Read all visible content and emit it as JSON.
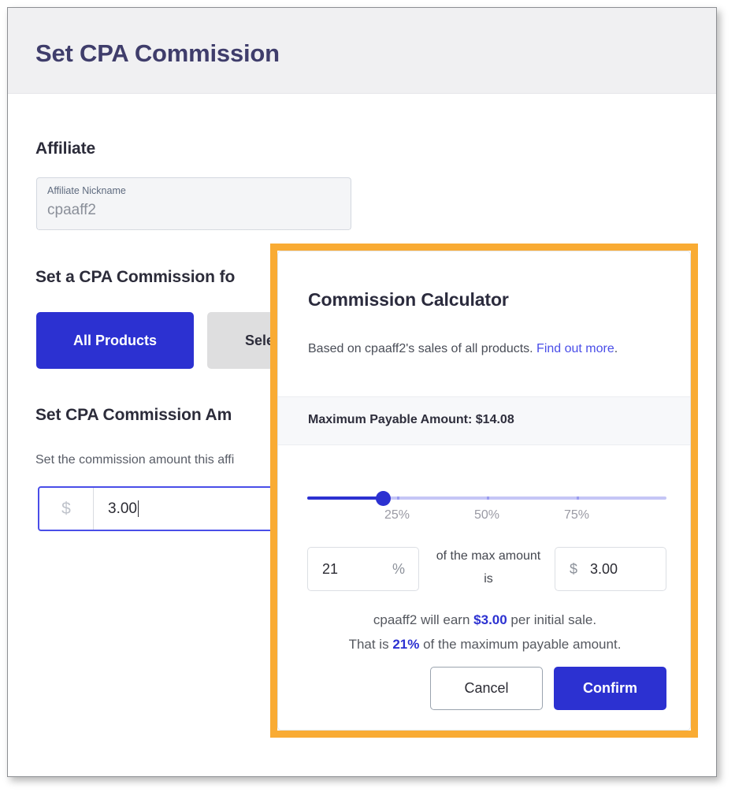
{
  "header": {
    "title": "Set CPA Commission"
  },
  "affiliate": {
    "heading": "Affiliate",
    "field_label": "Affiliate Nickname",
    "field_value": "cpaaff2"
  },
  "scope": {
    "heading": "Set a CPA Commission fo",
    "buttons": [
      {
        "label": "All Products",
        "selected": true
      },
      {
        "label": "Selec",
        "selected": false
      }
    ]
  },
  "amount_section": {
    "heading": "Set CPA Commission Am",
    "helper": "Set the commission amount this affi",
    "currency_symbol": "$",
    "value": "3.00"
  },
  "modal": {
    "title": "Commission Calculator",
    "description_prefix": "Based on cpaaff2's sales of all products. ",
    "description_link": "Find out more",
    "description_suffix": ".",
    "max_payable_label": "Maximum Payable Amount: $14.08",
    "slider": {
      "value_percent": 21,
      "min": 0,
      "max": 100,
      "tick_labels": [
        "25%",
        "50%",
        "75%"
      ],
      "tick_values": [
        25,
        50,
        75
      ]
    },
    "percent_input": {
      "value": "21",
      "suffix": "%"
    },
    "middle_label": "of the max amount is",
    "amount_input": {
      "prefix": "$",
      "value": "3.00"
    },
    "summary_line1_pre": "cpaaff2 will earn ",
    "summary_line1_bold": "$3.00",
    "summary_line1_post": " per initial sale.",
    "summary_line2_pre": "That is ",
    "summary_line2_bold": "21%",
    "summary_line2_post": " of the maximum payable amount.",
    "cancel_label": "Cancel",
    "confirm_label": "Confirm"
  },
  "colors": {
    "accent_blue": "#2c31d1",
    "highlight_orange": "#f9ab33",
    "header_gray": "#f0f0f2",
    "link_blue": "#4a4ee8"
  }
}
